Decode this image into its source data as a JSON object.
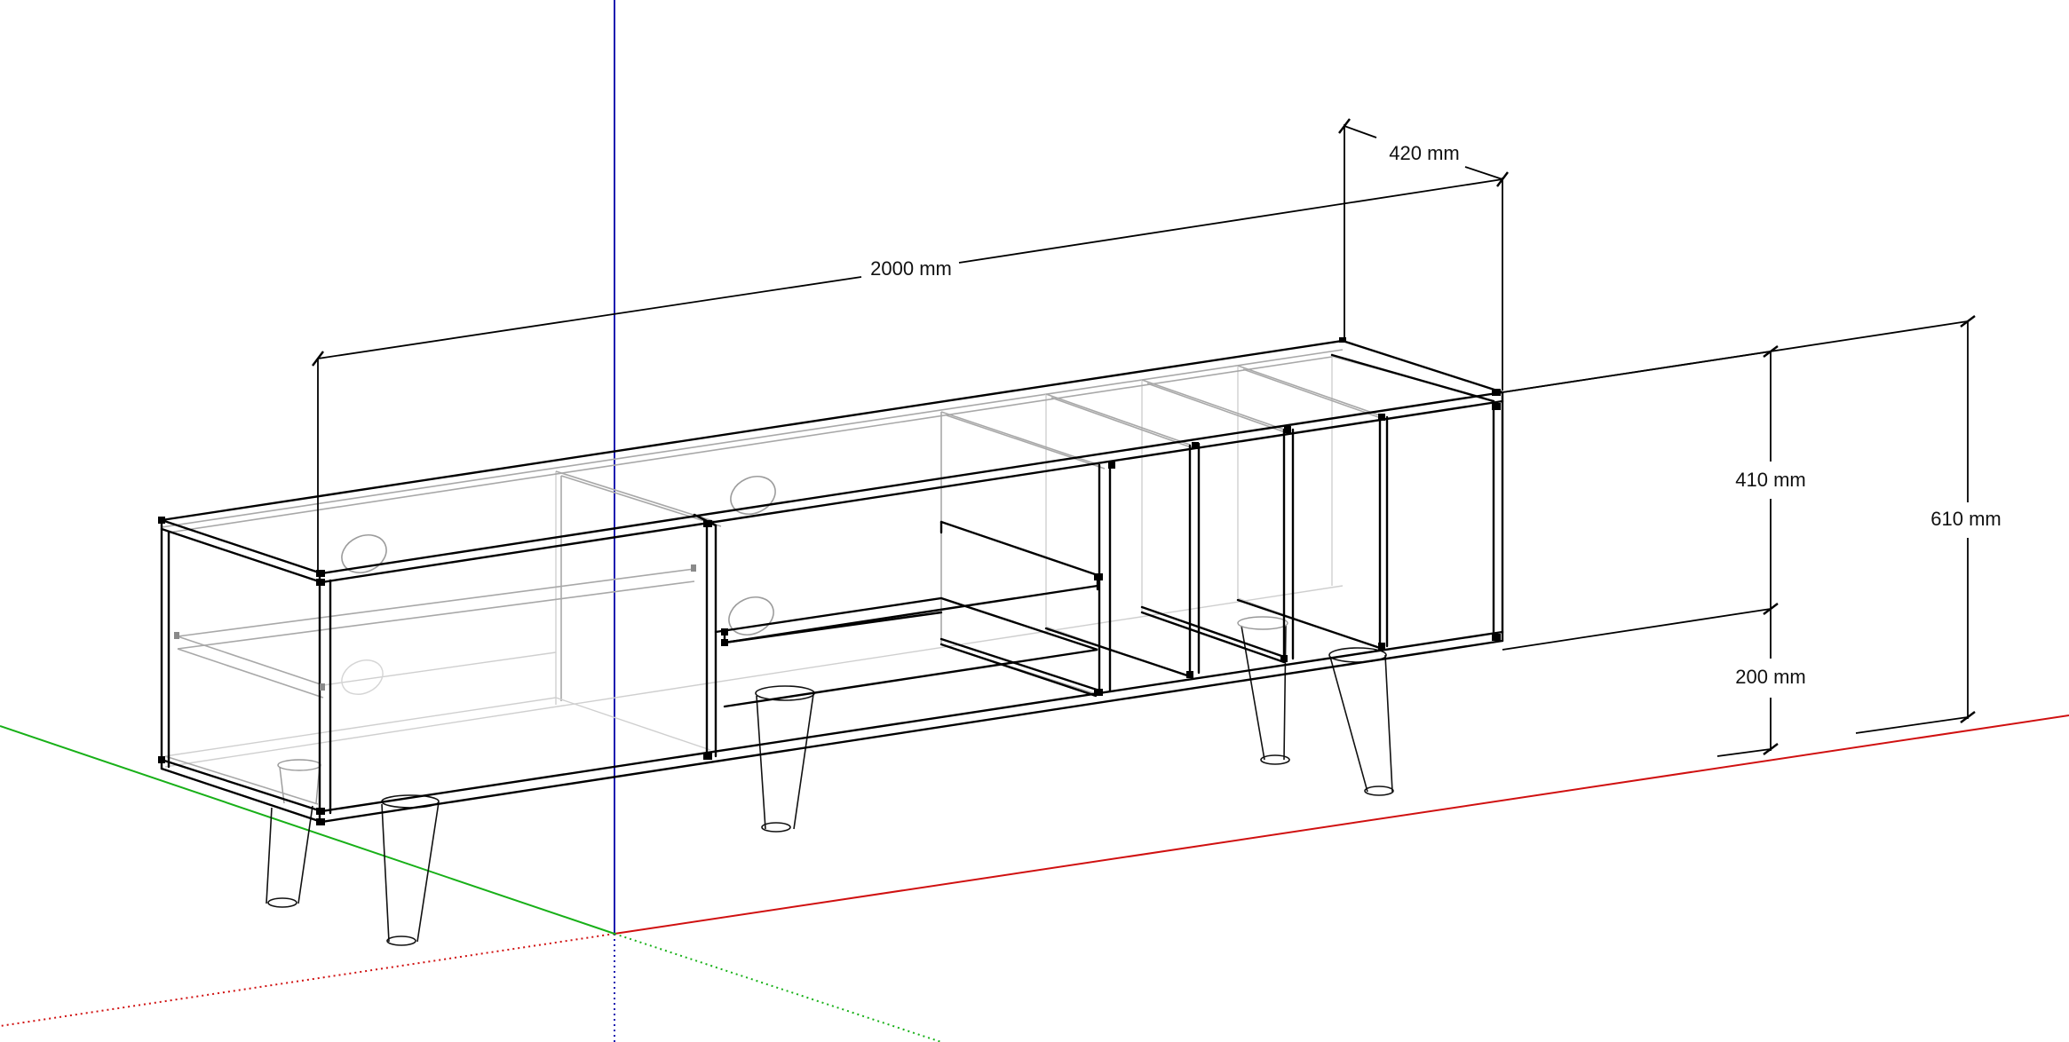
{
  "dimensions": {
    "length_label": "2000 mm",
    "depth_label": "420 mm",
    "body_height_label": "410 mm",
    "leg_height_label": "200 mm",
    "total_height_label": "610 mm"
  },
  "colors": {
    "axis_red": "#d01010",
    "axis_green": "#18b018",
    "axis_blue": "#1a1ab0",
    "edge": "#000000",
    "hidden_edge": "#a8a8a8"
  }
}
